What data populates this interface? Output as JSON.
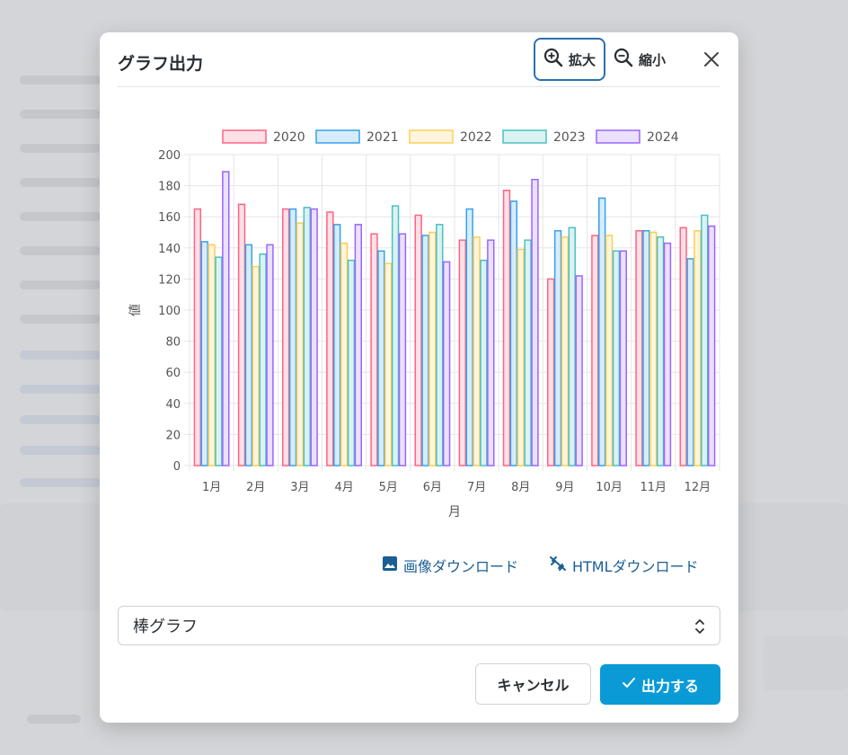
{
  "modal": {
    "title": "グラフ出力",
    "zoom_in_label": "拡大",
    "zoom_out_label": "縮小",
    "download_image_label": "画像ダウンロード",
    "download_html_label": "HTMLダウンロード",
    "chart_type_selected": "棒グラフ",
    "cancel_label": "キャンセル",
    "submit_label": "出力する"
  },
  "icons": {
    "zoom_in": "zoom-in-icon",
    "zoom_out": "zoom-out-icon",
    "close": "close-icon",
    "image": "image-icon",
    "link_off": "link-off-icon",
    "select_arrows": "select-arrows-icon",
    "check": "check-icon"
  },
  "colors": {
    "primary": "#0a9bd6",
    "link": "#1a5e93",
    "focus_border": "#2c6fae"
  },
  "chart_data": {
    "type": "bar",
    "categories": [
      "1月",
      "2月",
      "3月",
      "4月",
      "5月",
      "6月",
      "7月",
      "8月",
      "9月",
      "10月",
      "11月",
      "12月"
    ],
    "series": [
      {
        "name": "2020",
        "color": "#ff6384",
        "fill": "#ffe0e6",
        "values": [
          165,
          168,
          165,
          163,
          149,
          161,
          145,
          177,
          120,
          148,
          151,
          153
        ]
      },
      {
        "name": "2021",
        "color": "#36a2eb",
        "fill": "#d7ecfb",
        "values": [
          144,
          142,
          165,
          155,
          138,
          148,
          165,
          170,
          151,
          172,
          151,
          133
        ]
      },
      {
        "name": "2022",
        "color": "#ffcd56",
        "fill": "#fff5dd",
        "values": [
          142,
          128,
          156,
          143,
          130,
          150,
          147,
          139,
          147,
          148,
          150,
          151
        ]
      },
      {
        "name": "2023",
        "color": "#4bc0c0",
        "fill": "#dbf2f2",
        "values": [
          134,
          136,
          166,
          132,
          167,
          155,
          132,
          145,
          153,
          138,
          147,
          161
        ]
      },
      {
        "name": "2024",
        "color": "#9966ff",
        "fill": "#ebe0ff",
        "values": [
          189,
          142,
          165,
          155,
          149,
          131,
          145,
          184,
          122,
          138,
          143,
          154
        ]
      }
    ],
    "xlabel": "月",
    "ylabel": "値",
    "ylim": [
      0,
      200
    ],
    "yticks": [
      0,
      20,
      40,
      60,
      80,
      100,
      120,
      140,
      160,
      180,
      200
    ],
    "grid": true,
    "legend_position": "top"
  }
}
